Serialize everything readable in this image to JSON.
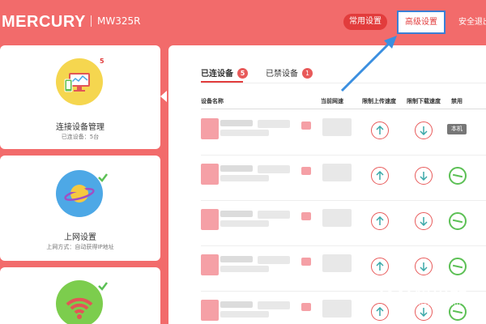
{
  "header": {
    "logo": "MERCURY",
    "model": "MW325R",
    "nav": {
      "common": "常用设置",
      "advanced": "高级设置",
      "exit": "安全退出"
    }
  },
  "sidebar": {
    "cards": [
      {
        "title": "连接设备管理",
        "subtitle": "已连设备：5台",
        "badge": "5",
        "icon": "devices-monitor-icon"
      },
      {
        "title": "上网设置",
        "subtitle": "上网方式：自动获得IP地址",
        "icon": "planet-icon"
      },
      {
        "title": "",
        "subtitle": "",
        "icon": "wifi-icon"
      }
    ]
  },
  "main": {
    "tabs": [
      {
        "label": "已连设备",
        "count": "5",
        "active": true
      },
      {
        "label": "已禁设备",
        "count": "1",
        "active": false
      }
    ],
    "columns": {
      "name": "设备名称",
      "speed": "当前网速",
      "up": "限制上传速度",
      "down": "限制下载速度",
      "block": "禁用"
    },
    "local_tag": "本机"
  },
  "watermark": {
    "cn": "路由器",
    "en": "luyouqi.com"
  },
  "colors": {
    "brand": "#f26b6b",
    "accent_red": "#e23c3c",
    "highlight_blue": "#3b7fd6",
    "block_green": "#5cc055"
  }
}
